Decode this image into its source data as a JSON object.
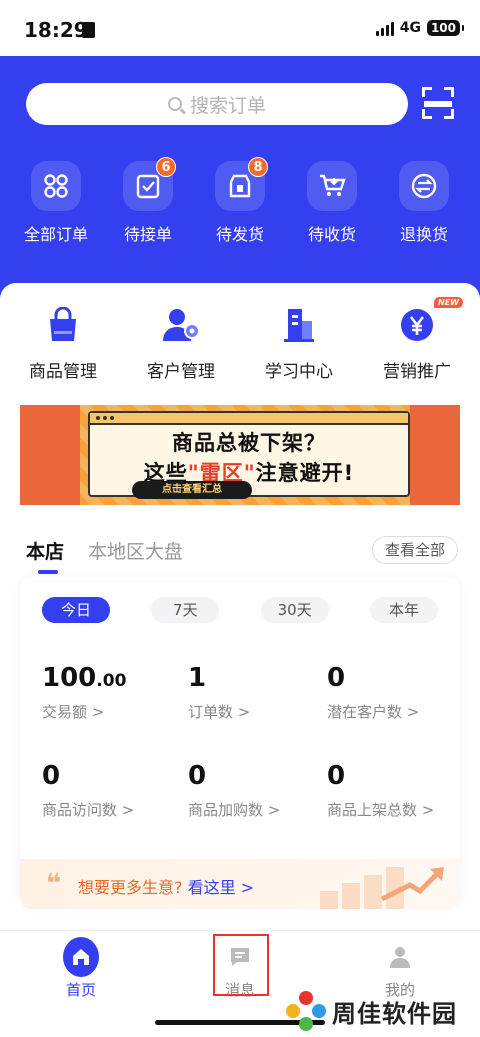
{
  "status": {
    "time": "18:29",
    "network": "4G",
    "battery": "100"
  },
  "search": {
    "placeholder": "搜索订单"
  },
  "orders": [
    {
      "label": "全部订单",
      "icon": "grid-icon",
      "badge": ""
    },
    {
      "label": "待接单",
      "icon": "clipboard-check-icon",
      "badge": "6"
    },
    {
      "label": "待发货",
      "icon": "package-icon",
      "badge": "8"
    },
    {
      "label": "待收货",
      "icon": "cart-icon",
      "badge": ""
    },
    {
      "label": "退换货",
      "icon": "exchange-icon",
      "badge": ""
    }
  ],
  "tools": [
    {
      "label": "商品管理",
      "icon": "shopping-bag-icon"
    },
    {
      "label": "客户管理",
      "icon": "user-gear-icon"
    },
    {
      "label": "学习中心",
      "icon": "building-icon"
    },
    {
      "label": "营销推广",
      "icon": "yuan-coin-icon",
      "tag": "NEW"
    }
  ],
  "banner": {
    "line1": "商品总被下架？",
    "line2_a": "这些",
    "line2_hl": "\"雷区\"",
    "line2_b": "注意避开!",
    "cta": "点击查看汇总"
  },
  "tabs": {
    "store": "本店",
    "region": "本地区大盘",
    "view_all": "查看全部"
  },
  "periods": [
    "今日",
    "7天",
    "30天",
    "本年"
  ],
  "metrics": [
    {
      "value": "100",
      "decimals": ".00",
      "label": "交易额 >"
    },
    {
      "value": "1",
      "label": "订单数 >"
    },
    {
      "value": "0",
      "label": "潜在客户数 >"
    },
    {
      "value": "0",
      "label": "商品访问数 >"
    },
    {
      "value": "0",
      "label": "商品加购数 >"
    },
    {
      "value": "0",
      "label": "商品上架总数 >"
    }
  ],
  "promo": {
    "quote": "❝",
    "text": "想要更多生意?",
    "link": "看这里 >"
  },
  "nav": {
    "home": "首页",
    "messages": "消息",
    "mine": "我的"
  },
  "watermark": {
    "text": "周佳软件园"
  },
  "colors": {
    "primary": "#3440f0",
    "badge": "#ff6a2a",
    "highlight": "#e8342a"
  }
}
